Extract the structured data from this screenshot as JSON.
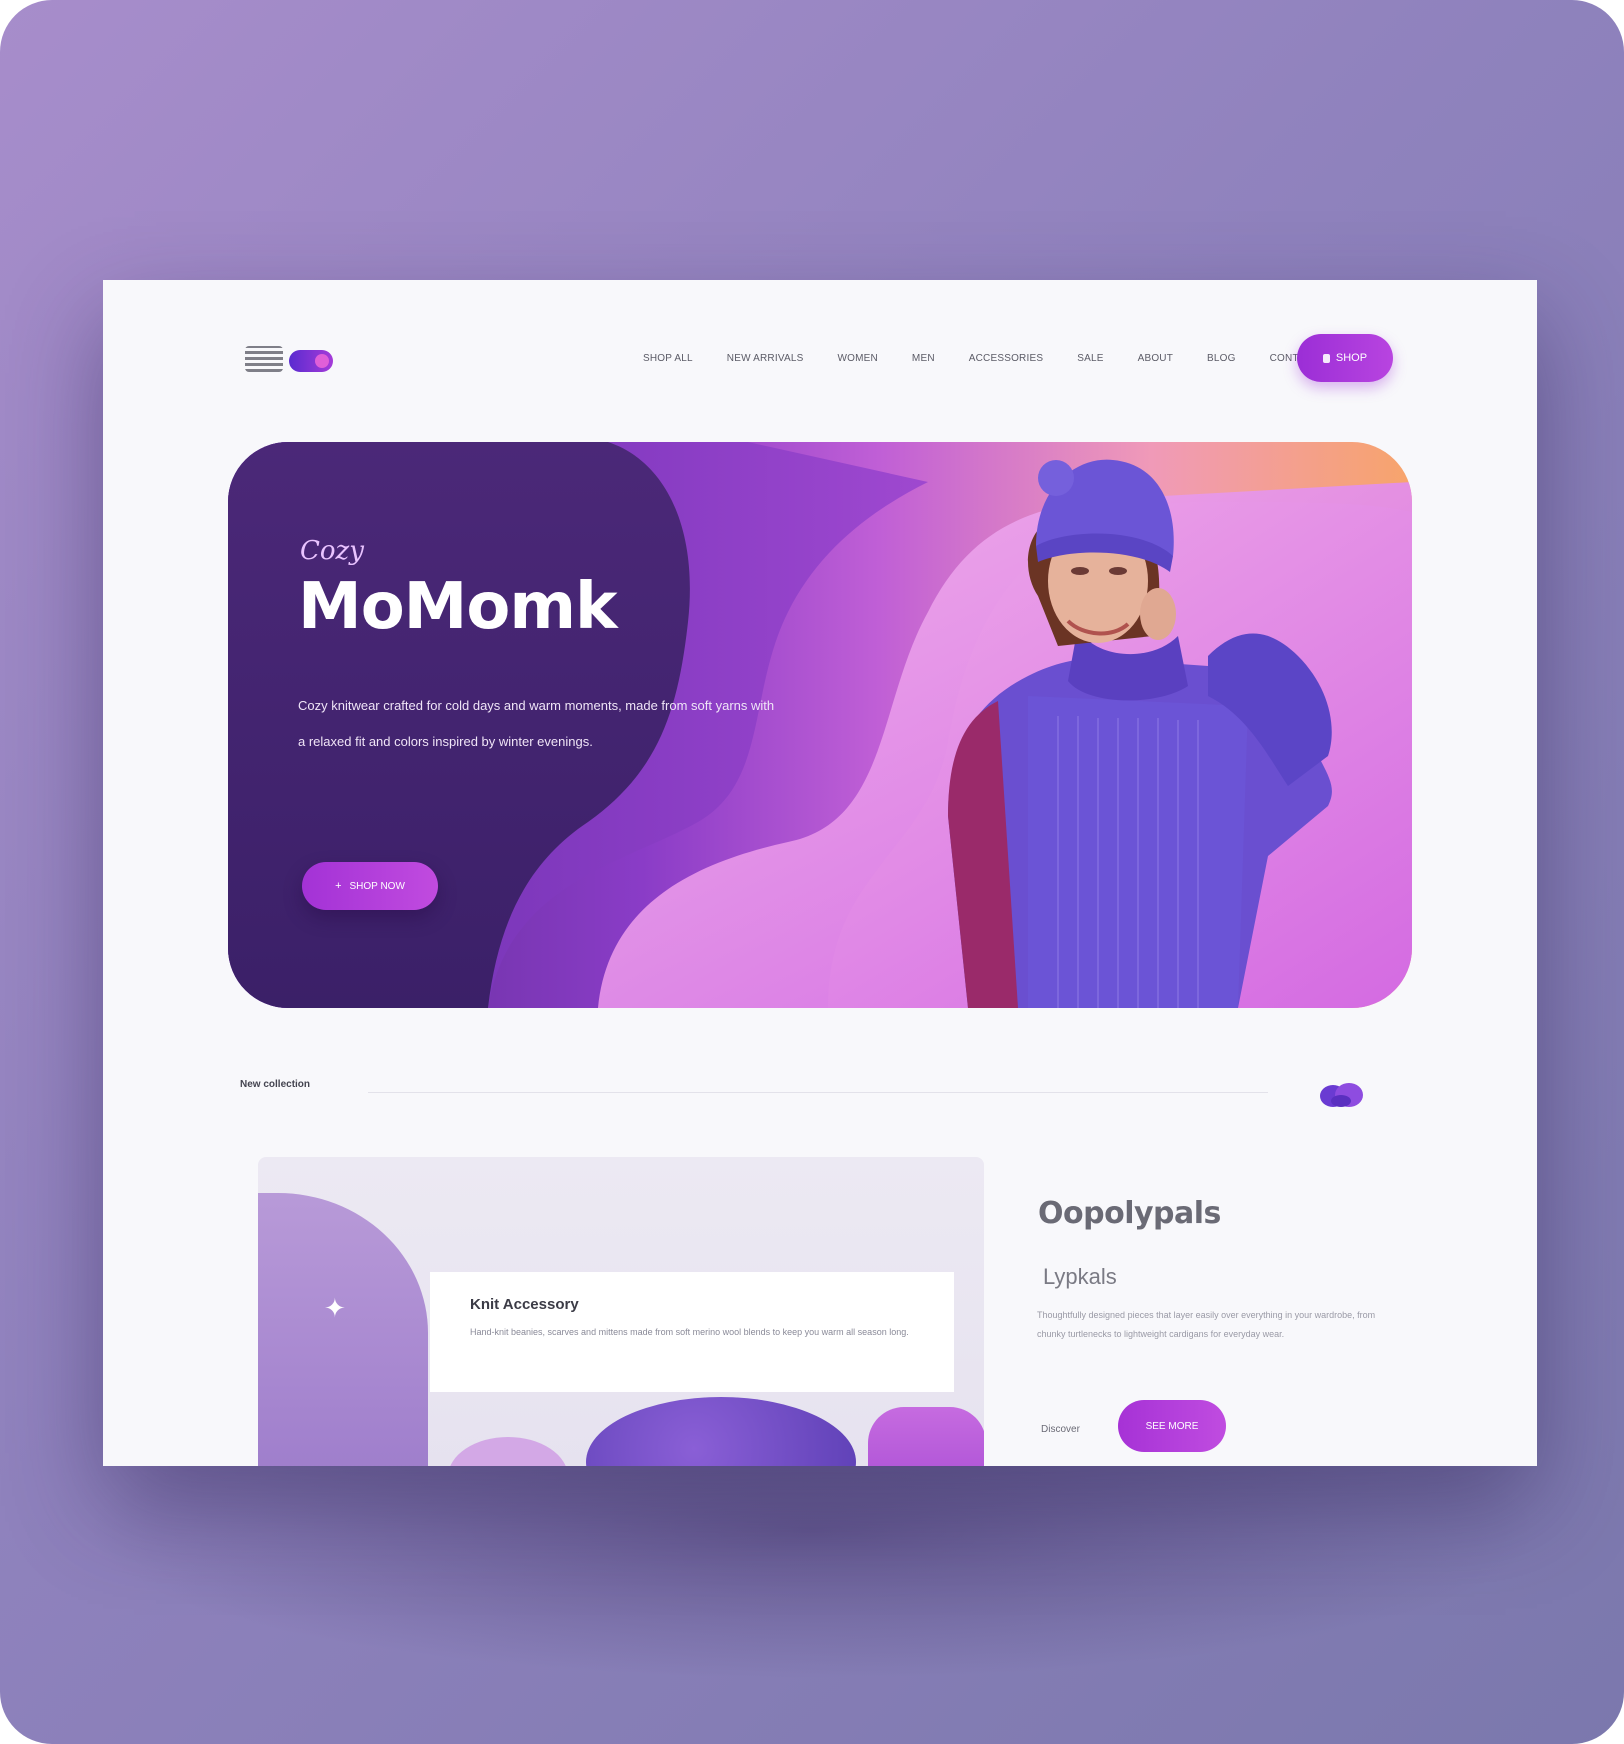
{
  "nav": {
    "items": [
      "SHOP ALL",
      "NEW ARRIVALS",
      "WOMEN",
      "MEN",
      "ACCESSORIES",
      "SALE",
      "ABOUT",
      "BLOG",
      "CONTACT"
    ],
    "cta_label": "SHOP"
  },
  "hero": {
    "kicker": "Cozy",
    "title": "MoMomk",
    "description": "Cozy knitwear crafted for cold days and warm moments, made from soft yarns with a relaxed fit and colors inspired by winter evenings.",
    "cta_label": "SHOP NOW"
  },
  "section": {
    "label": "New collection"
  },
  "feature": {
    "title": "Knit Accessory",
    "text": "Hand-knit beanies, scarves and mittens made from soft merino wool blends to keep you warm all season long."
  },
  "info": {
    "title": "Oopolypals",
    "subtitle": "Lypkals",
    "text": "Thoughtfully designed pieces that layer easily over everything in your wardrobe, from chunky turtlenecks to lightweight cardigans for everyday wear.",
    "link_label": "Discover",
    "button_label": "SEE MORE"
  },
  "colors": {
    "accent": "#a632d6",
    "hero_dark": "#4a2a7a",
    "background": "#f8f8fb"
  }
}
